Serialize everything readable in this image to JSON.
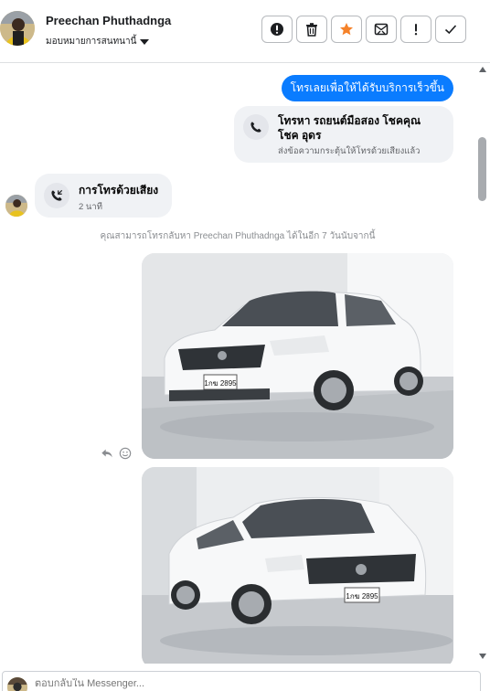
{
  "header": {
    "name": "Preechan Phuthadnga",
    "assign_label": "มอบหมายการสนทนานี้",
    "actions": [
      {
        "name": "spam-button",
        "icon": "exclamation-circle-icon"
      },
      {
        "name": "delete-button",
        "icon": "trash-icon"
      },
      {
        "name": "star-button",
        "icon": "star-icon"
      },
      {
        "name": "archive-button",
        "icon": "envelope-x-icon"
      },
      {
        "name": "follow-up-button",
        "icon": "exclamation-icon"
      },
      {
        "name": "done-button",
        "icon": "check-icon"
      }
    ]
  },
  "messages": {
    "outgoing_text": "โทรเลยเพื่อให้ได้รับบริการเร็วขึ้น",
    "outgoing_call": {
      "title": "โทรหา รถยนต์มือสอง โชคคุณ โชค อุดร",
      "subtitle": "ส่งข้อความกระตุ้นให้โทรด้วยเสียงแล้ว"
    },
    "incoming_call": {
      "title": "การโทรด้วยเสียง",
      "duration": "2 นาที"
    },
    "system_note": "คุณสามารถโทรกลับหา Preechan Phuthadnga ได้ในอีก 7 วันนับจากนี้",
    "photos": [
      {
        "plate": "1กฆ 2895",
        "alt": "white sedan front-left view"
      },
      {
        "plate": "1กฆ 2895",
        "alt": "white sedan front-left low view"
      }
    ]
  },
  "composer": {
    "placeholder": "ตอบกลับใน Messenger..."
  },
  "colors": {
    "accent": "#0a7cff",
    "bubble_gray": "#f0f2f5",
    "star": "#f5822a"
  }
}
